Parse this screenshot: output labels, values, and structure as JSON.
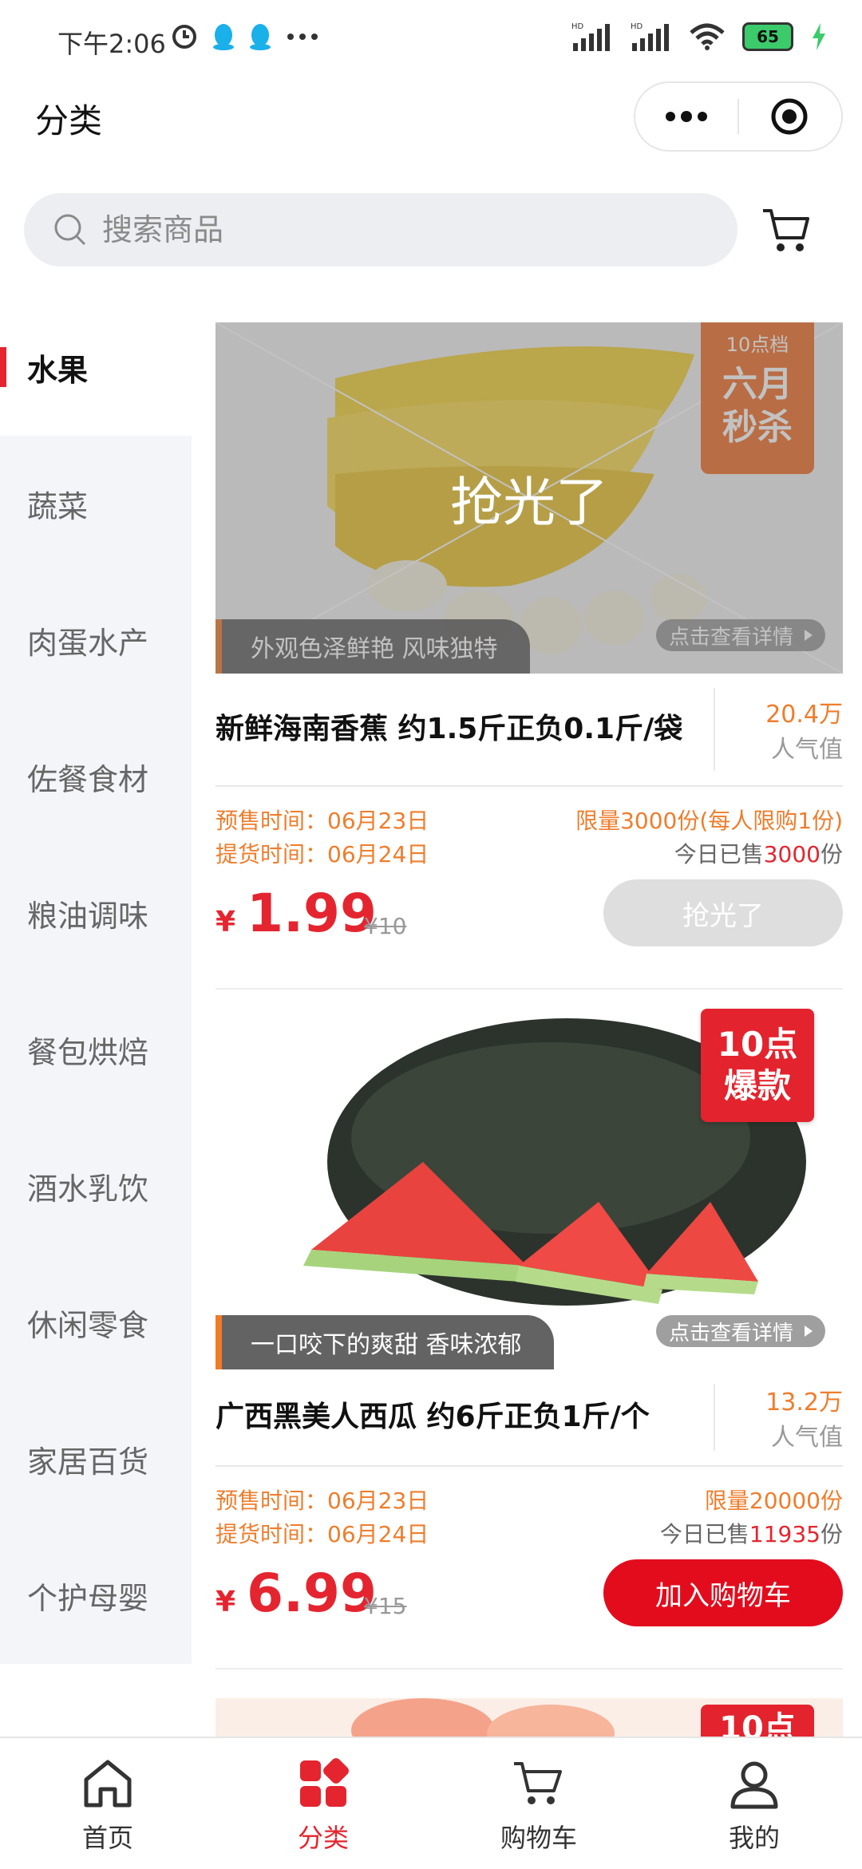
{
  "status_bar": {
    "time": "下午2:06",
    "battery": "65",
    "icons_left": [
      "clock-icon",
      "qq-icon",
      "qq-icon",
      "more-dots-icon"
    ],
    "icons_right": [
      "signal-hd-icon",
      "signal-hd-icon",
      "wifi-icon",
      "battery-icon",
      "charging-icon"
    ]
  },
  "header": {
    "title": "分类"
  },
  "search": {
    "placeholder": "搜索商品"
  },
  "sidebar": {
    "items": [
      {
        "label": "水果",
        "active": true
      },
      {
        "label": "蔬菜"
      },
      {
        "label": "肉蛋水产"
      },
      {
        "label": "佐餐食材"
      },
      {
        "label": "粮油调味"
      },
      {
        "label": "餐包烘焙"
      },
      {
        "label": "酒水乳饮"
      },
      {
        "label": "休闲零食"
      },
      {
        "label": "家居百货"
      },
      {
        "label": "个护母婴"
      }
    ]
  },
  "products": [
    {
      "name": "新鲜海南香蕉 约1.5斤正负0.1斤/袋",
      "popularity": "20.4万",
      "popularity_label": "人气值",
      "slogan": "外观色泽鲜艳 风味独特",
      "detail_label": "点击查看详情",
      "badge_top": "10点档",
      "badge_main": "六月秒杀",
      "soldout_overlay": "抢光了",
      "presale": "预售时间：06月23日",
      "pickup": "提货时间：06月24日",
      "limit": "限量3000份(每人限购1份)",
      "sold_prefix": "今日已售",
      "sold_count": "3000",
      "sold_suffix": "份",
      "currency": "¥",
      "price": "1.99",
      "original_price": "¥10",
      "button": "抢光了"
    },
    {
      "name": "广西黑美人西瓜 约6斤正负1斤/个",
      "popularity": "13.2万",
      "popularity_label": "人气值",
      "slogan": "一口咬下的爽甜 香味浓郁",
      "detail_label": "点击查看详情",
      "badge_line1": "10点",
      "badge_line2": "爆款",
      "presale": "预售时间：06月23日",
      "pickup": "提货时间：06月24日",
      "limit": "限量20000份",
      "sold_prefix": "今日已售",
      "sold_count": "11935",
      "sold_suffix": "份",
      "currency": "¥",
      "price": "6.99",
      "original_price": "¥15",
      "button": "加入购物车"
    },
    {
      "badge_line1": "10点"
    }
  ],
  "bottom_nav": [
    {
      "label": "首页",
      "icon": "home-icon"
    },
    {
      "label": "分类",
      "icon": "category-icon",
      "active": true
    },
    {
      "label": "购物车",
      "icon": "cart-icon"
    },
    {
      "label": "我的",
      "icon": "user-icon"
    }
  ],
  "colors": {
    "accent": "#e4252f",
    "orange": "#ef7d2c",
    "sidebar_bg": "#f3f5f9"
  }
}
